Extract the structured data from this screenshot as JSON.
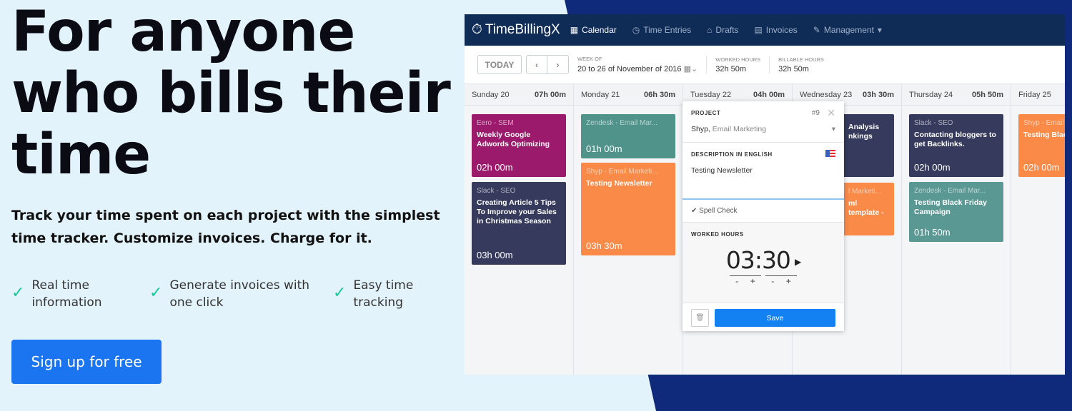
{
  "hero": {
    "title": "For anyone who bills their time",
    "subtitle": "Track your time spent on each project with the simplest time tracker. Customize invoices. Charge for it.",
    "features": [
      "Real time information",
      "Generate invoices with one click",
      "Easy time tracking"
    ],
    "cta": "Sign up for free"
  },
  "colors": {
    "background": "#e3f3fc",
    "accent_dark": "#0f2a7a",
    "check": "#19c99a",
    "cta": "#1b74f0"
  },
  "app": {
    "logo": "TimeBillingX",
    "nav": [
      "Calendar",
      "Time Entries",
      "Drafts",
      "Invoices",
      "Management"
    ],
    "toolbar": {
      "today": "TODAY",
      "week_label": "WEEK OF",
      "week_value": "20 to 26 of November of 2016",
      "worked_label": "WORKED HOURS",
      "worked_value": "32h 50m",
      "billable_label": "BILLABLE HOURS",
      "billable_value": "32h 50m"
    },
    "days": [
      {
        "name": "Sunday 20",
        "total": "07h 00m"
      },
      {
        "name": "Monday 21",
        "total": "06h 30m"
      },
      {
        "name": "Tuesday 22",
        "total": "04h 00m"
      },
      {
        "name": "Wednesday 23",
        "total": "03h 30m"
      },
      {
        "name": "Thursday 24",
        "total": "05h 50m"
      },
      {
        "name": "Friday 25",
        "total": ""
      }
    ],
    "cards": [
      {
        "project": "Eero - SEM",
        "title": "Weekly Google Adwords Optimizing",
        "hours": "02h 00m",
        "color": "#9b1a6c"
      },
      {
        "project": "Slack - SEO",
        "title": "Creating Article 5 Tips To Improve your Sales in Christmas Season",
        "hours": "03h 00m",
        "color": "#363a5c"
      },
      {
        "project": "Zendesk - Email Mar...",
        "title": "",
        "hours": "01h 00m",
        "color": "#4f938a"
      },
      {
        "project": "Shyp - Email Marketi...",
        "title": "Testing Newsletter",
        "hours": "03h 30m",
        "color": "#f98a48"
      },
      {
        "project": "",
        "title": "Analysis\nnkings",
        "hours": "",
        "color": "#363a5c"
      },
      {
        "project": "l Marketi...",
        "title": "ml template -",
        "hours": "",
        "color": "#f98a48"
      },
      {
        "project": "Slack - SEO",
        "title": "Contacting bloggers to get Backlinks.",
        "hours": "02h 00m",
        "color": "#363a5c"
      },
      {
        "project": "Zendesk - Email Mar...",
        "title": "Testing Black Friday Campaign",
        "hours": "01h 50m",
        "color": "#5a9893"
      },
      {
        "project": "Shyp - Email",
        "title": "Testing Blac campaign",
        "hours": "02h 00m",
        "color": "#f98a48"
      }
    ],
    "popup": {
      "project_label": "PROJECT",
      "number": "#9",
      "client": "Shyp,",
      "project": "Email Marketing",
      "desc_label": "DESCRIPTION IN ENGLISH",
      "description": "Testing Newsletter",
      "spell": "Spell Check",
      "worked_label": "WORKED HOURS",
      "hh": "03",
      "mm": "30",
      "minus": "-",
      "plus": "+",
      "save": "Save"
    }
  }
}
